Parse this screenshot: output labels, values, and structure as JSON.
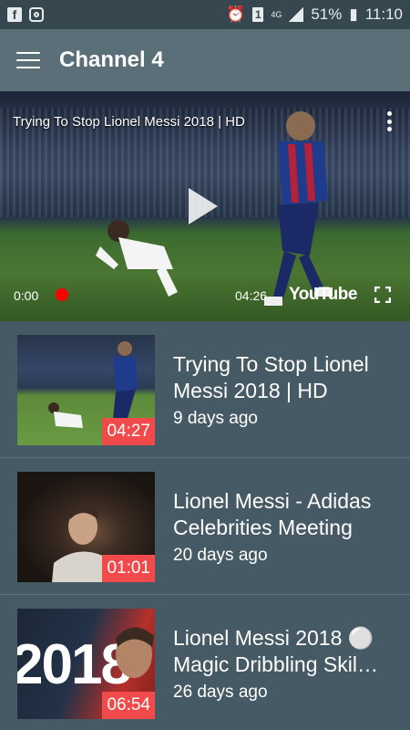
{
  "status_bar": {
    "battery": "51%",
    "time": "11:10",
    "notification_badge": "1",
    "network": "4G"
  },
  "app_bar": {
    "title": "Channel 4"
  },
  "player": {
    "title": "Trying To Stop Lionel Messi 2018 | HD",
    "current_time": "0:00",
    "duration": "04:26",
    "brand": "YouTube"
  },
  "videos": [
    {
      "title_line1": "Trying To Stop Lionel",
      "title_line2": "Messi 2018 | HD",
      "date": "9 days ago",
      "duration": "04:27"
    },
    {
      "title_line1": "Lionel Messi - Adidas",
      "title_line2": "Celebrities Meeting",
      "date": "20 days ago",
      "duration": "01:01"
    },
    {
      "title_line1": "Lionel Messi 2018 ⚪",
      "title_line2": "Magic Dribbling Skil…",
      "date": "26 days ago",
      "duration": "06:54",
      "thumb_text": "2018"
    }
  ],
  "colors": {
    "background": "#455a64",
    "app_bar": "#5b6f79",
    "status_bar": "#37474f",
    "duration_badge": "#f04a4a",
    "record_dot": "#ff0000"
  }
}
